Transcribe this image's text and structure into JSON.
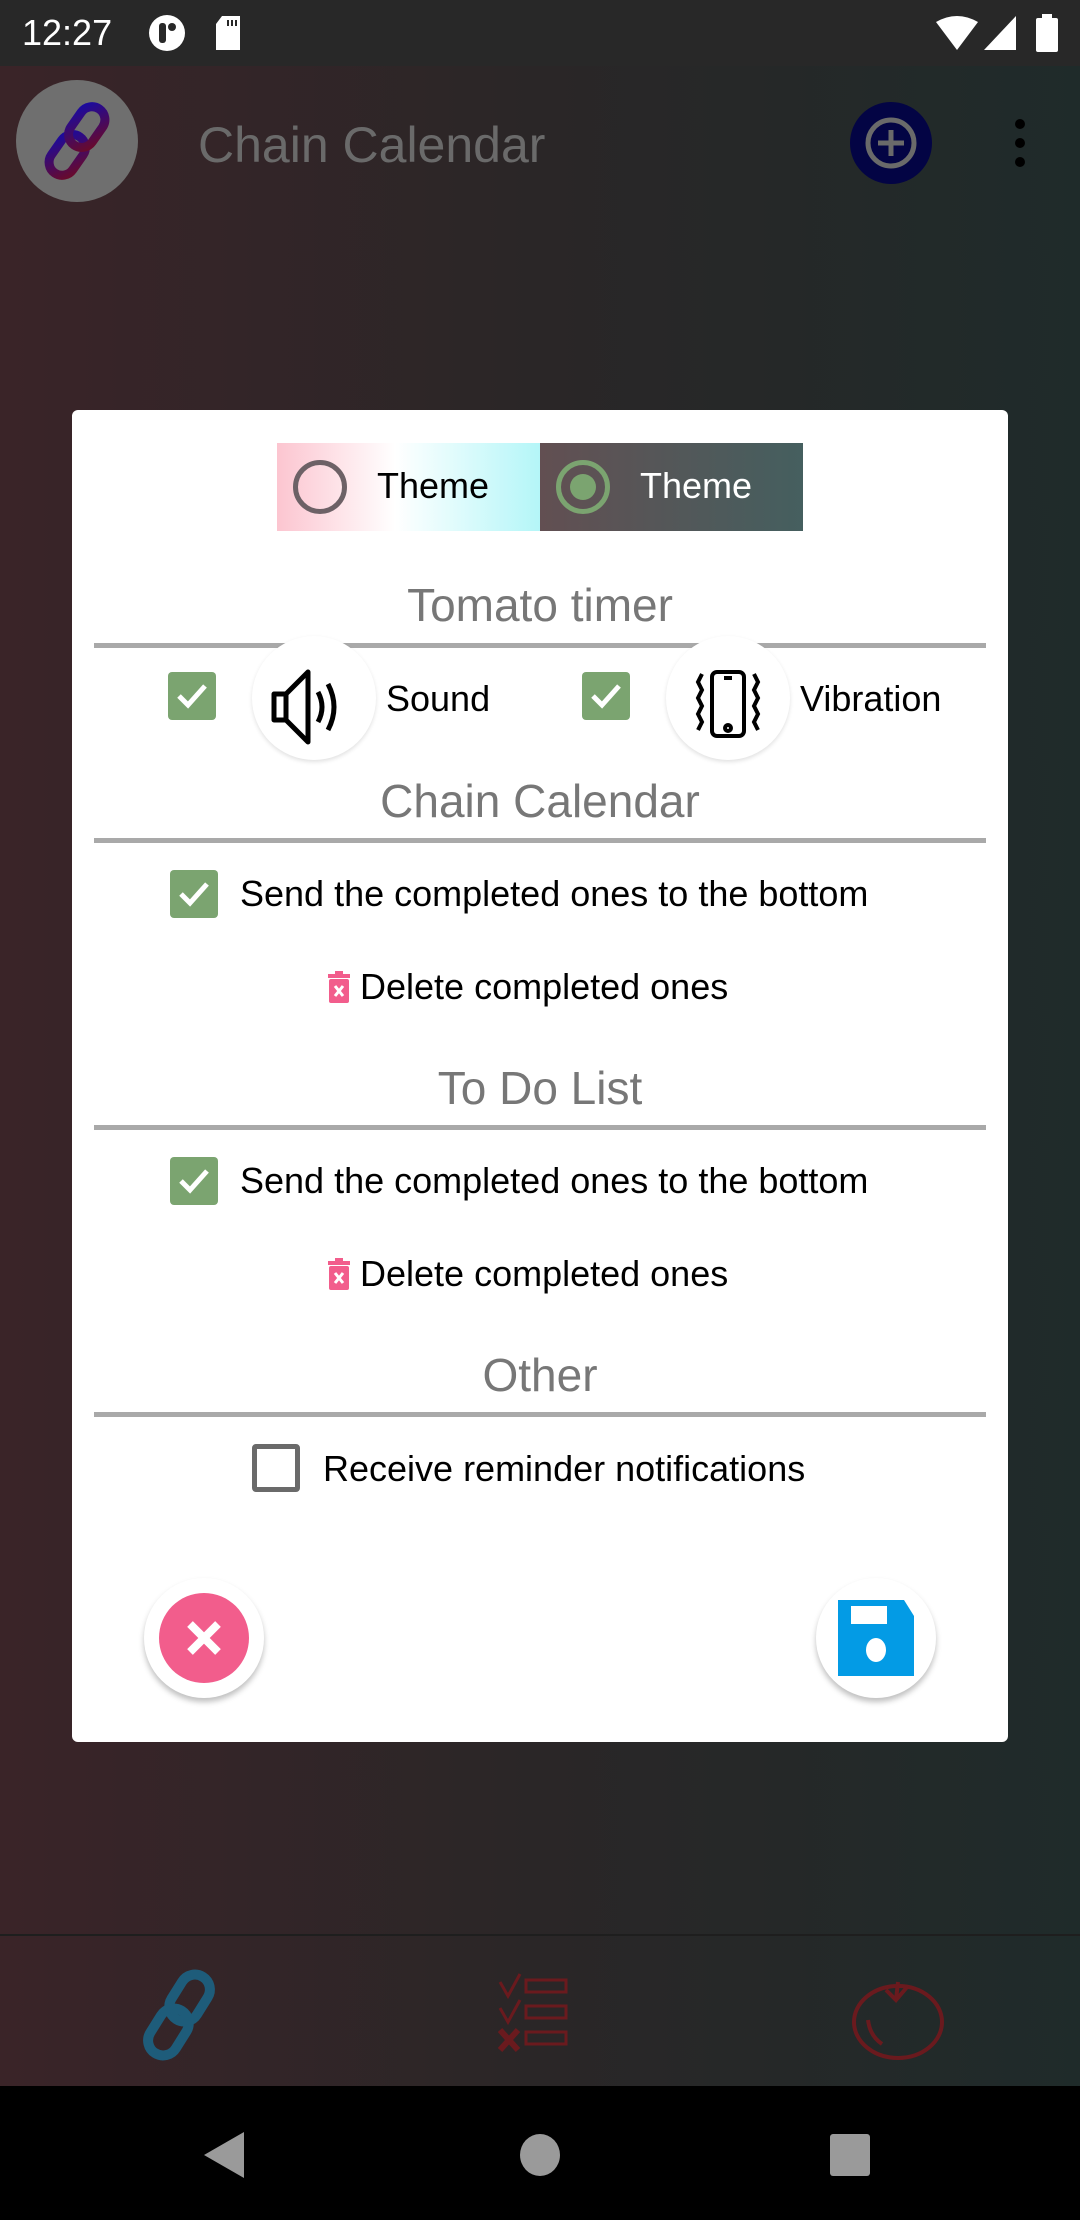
{
  "status_bar": {
    "time": "12:27",
    "icons": [
      "notification-icon",
      "sd-card-icon",
      "wifi-icon",
      "cell-signal-icon",
      "battery-icon"
    ]
  },
  "app_bar": {
    "title": "Chain Calendar",
    "logo_icon": "chain-link-icon",
    "add_icon": "add-circle-icon",
    "more_icon": "more-vert-icon"
  },
  "dialog": {
    "themes": [
      {
        "label": "Theme",
        "selected": false,
        "style": "light"
      },
      {
        "label": "Theme",
        "selected": true,
        "style": "dark"
      }
    ],
    "tomato_timer": {
      "title": "Tomato timer",
      "sound": {
        "label": "Sound",
        "checked": true
      },
      "vibration": {
        "label": "Vibration",
        "checked": true
      }
    },
    "chain_calendar": {
      "title": "Chain Calendar",
      "send_bottom": {
        "label": "Send the completed ones to the bottom",
        "checked": true
      },
      "delete_label": "Delete completed ones"
    },
    "todo_list": {
      "title": "To Do List",
      "send_bottom": {
        "label": "Send the completed ones to the bottom",
        "checked": true
      },
      "delete_label": "Delete completed ones"
    },
    "other": {
      "title": "Other",
      "reminders": {
        "label": "Receive reminder notifications",
        "checked": false
      }
    },
    "cancel_icon": "close-circle-icon",
    "save_icon": "floppy-save-icon"
  },
  "bottom_nav": {
    "items": [
      {
        "name": "chain-calendar",
        "icon": "chain-link-icon"
      },
      {
        "name": "todo-list",
        "icon": "checklist-icon"
      },
      {
        "name": "tomato-timer",
        "icon": "tomato-icon"
      }
    ]
  },
  "colors": {
    "check_green": "#7ba470",
    "delete_pink": "#f25d8c",
    "save_blue": "#039be5",
    "section_gray": "#777777"
  }
}
